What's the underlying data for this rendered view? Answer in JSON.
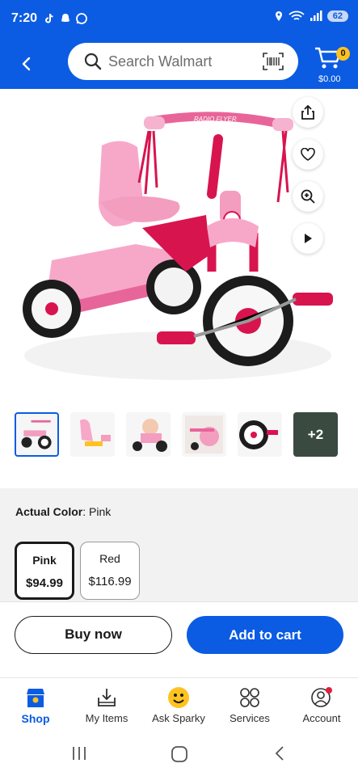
{
  "status_bar": {
    "time": "7:20",
    "battery": "62"
  },
  "header": {
    "search_placeholder": "Search Walmart",
    "cart_count": "0",
    "cart_total": "$0.00"
  },
  "product": {
    "image_alt": "Radio Flyer pink folding tricycle",
    "brand_text": "RADIO FLYER",
    "thumbnails_more": "+2",
    "color_label": "Actual Color",
    "color_value": ": Pink",
    "variants": [
      {
        "name": "Pink",
        "price": "$94.99"
      },
      {
        "name": "Red",
        "price": "$116.99"
      }
    ]
  },
  "actions": {
    "buy_now": "Buy now",
    "add_to_cart": "Add to cart"
  },
  "bottom_nav": [
    {
      "label": "Shop",
      "icon": "shop-icon"
    },
    {
      "label": "My Items",
      "icon": "my-items-icon"
    },
    {
      "label": "Ask Sparky",
      "icon": "sparky-icon"
    },
    {
      "label": "Services",
      "icon": "services-icon"
    },
    {
      "label": "Account",
      "icon": "account-icon"
    }
  ],
  "colors": {
    "brand_blue": "#0b5ce2",
    "spark_yellow": "#ffc220",
    "notification_red": "#e01e3c"
  }
}
